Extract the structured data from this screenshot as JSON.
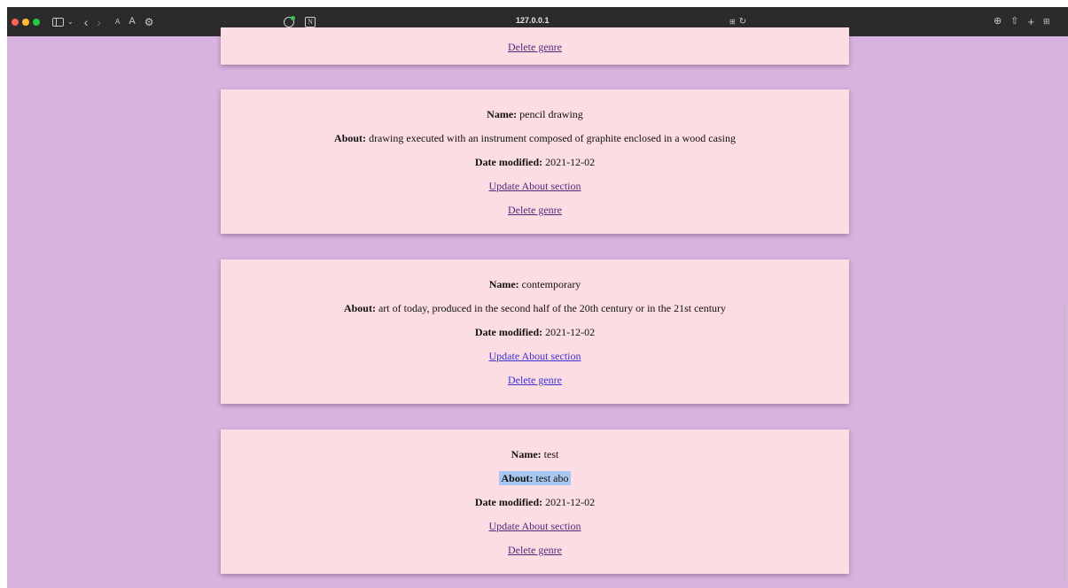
{
  "browser": {
    "url": "127.0.0.1",
    "traffic_lights": [
      "#ff5f57",
      "#febc2e",
      "#28c840"
    ],
    "left_icons": [
      "sidebar-icon",
      "chevron-down-icon",
      "back-icon",
      "forward-icon",
      "text-smaller-icon",
      "text-larger-icon",
      "settings-icon"
    ],
    "extension_icons": [
      "extension-icon",
      "notion-icon"
    ],
    "right_icons": [
      "download-icon",
      "share-icon",
      "new-tab-icon",
      "tab-overview-icon"
    ]
  },
  "labels": {
    "name": "Name:",
    "about": "About:",
    "date_modified": "Date modified:",
    "update_link": "Update About section",
    "delete_link": "Delete genre"
  },
  "genres": [
    {
      "name": "",
      "about": "",
      "date_modified": "",
      "update_label": "",
      "delete_label": "Delete genre"
    },
    {
      "name": "pencil drawing",
      "about": "drawing executed with an instrument composed of graphite enclosed in a wood casing",
      "date_modified": "2021-12-02",
      "update_label": "Update About section",
      "delete_label": "Delete genre"
    },
    {
      "name": "contemporary",
      "about": "art of today, produced in the second half of the 20th century or in the 21st century",
      "date_modified": "2021-12-02",
      "update_label": "Update About section",
      "delete_label": "Delete genre"
    },
    {
      "name": "test",
      "about": "test abo",
      "date_modified": "2021-12-02",
      "update_label": "Update About section",
      "delete_label": "Delete genre"
    }
  ],
  "colors": {
    "page_background": "#d9b3e0",
    "card_background": "#fcdde4",
    "link": "#3b2fd6",
    "visited_link": "#55267a",
    "selection": "#a9c7ee"
  }
}
